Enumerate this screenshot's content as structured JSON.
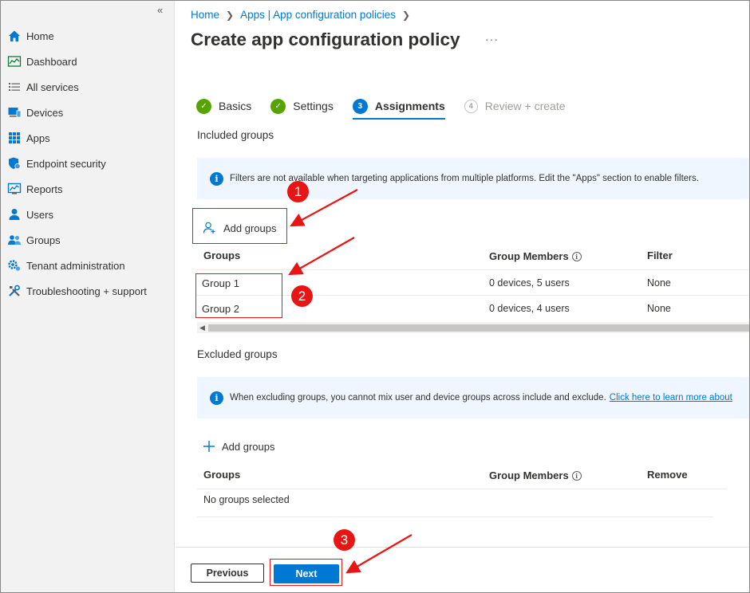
{
  "sidebar": {
    "collapse_glyph": "«",
    "items": [
      {
        "label": "Home",
        "icon": "home-icon"
      },
      {
        "label": "Dashboard",
        "icon": "dashboard-icon"
      },
      {
        "label": "All services",
        "icon": "list-icon"
      },
      {
        "label": "Devices",
        "icon": "devices-icon"
      },
      {
        "label": "Apps",
        "icon": "apps-grid-icon"
      },
      {
        "label": "Endpoint security",
        "icon": "shield-icon"
      },
      {
        "label": "Reports",
        "icon": "reports-icon"
      },
      {
        "label": "Users",
        "icon": "user-icon"
      },
      {
        "label": "Groups",
        "icon": "groups-icon"
      },
      {
        "label": "Tenant administration",
        "icon": "tenant-admin-icon"
      },
      {
        "label": "Troubleshooting + support",
        "icon": "tools-icon"
      }
    ]
  },
  "breadcrumb": {
    "items": [
      "Home",
      "Apps | App configuration policies"
    ]
  },
  "page": {
    "title": "Create app configuration policy",
    "more": "···"
  },
  "wizard": {
    "steps": [
      {
        "label": "Basics",
        "state": "done",
        "marker": "✓"
      },
      {
        "label": "Settings",
        "state": "done",
        "marker": "✓"
      },
      {
        "label": "Assignments",
        "state": "current",
        "marker": "3"
      },
      {
        "label": "Review + create",
        "state": "pending",
        "marker": "4"
      }
    ]
  },
  "included": {
    "heading": "Included groups",
    "info": "Filters are not available when targeting applications from multiple platforms. Edit the \"Apps\" section to enable filters.",
    "add_label": "Add groups",
    "columns": [
      "Groups",
      "Group Members",
      "Filter"
    ],
    "rows": [
      {
        "group": "Group 1",
        "members": "0 devices, 5 users",
        "filter": "None"
      },
      {
        "group": "Group 2",
        "members": "0 devices, 4 users",
        "filter": "None"
      }
    ]
  },
  "excluded": {
    "heading": "Excluded groups",
    "info": "When excluding groups, you cannot mix user and device groups across include and exclude.",
    "info_link": "Click here to learn more about",
    "add_label": "Add groups",
    "columns": [
      "Groups",
      "Group Members",
      "Remove"
    ],
    "empty": "No groups selected"
  },
  "footer": {
    "previous_label": "Previous",
    "next_label": "Next"
  },
  "annotations": {
    "markers": [
      "1",
      "2",
      "3"
    ],
    "color": "#e81515"
  },
  "colors": {
    "accent": "#0078d4",
    "success": "#57a300",
    "sidebar_bg": "#f2f2f2",
    "info_bg": "#f0f6ff"
  }
}
